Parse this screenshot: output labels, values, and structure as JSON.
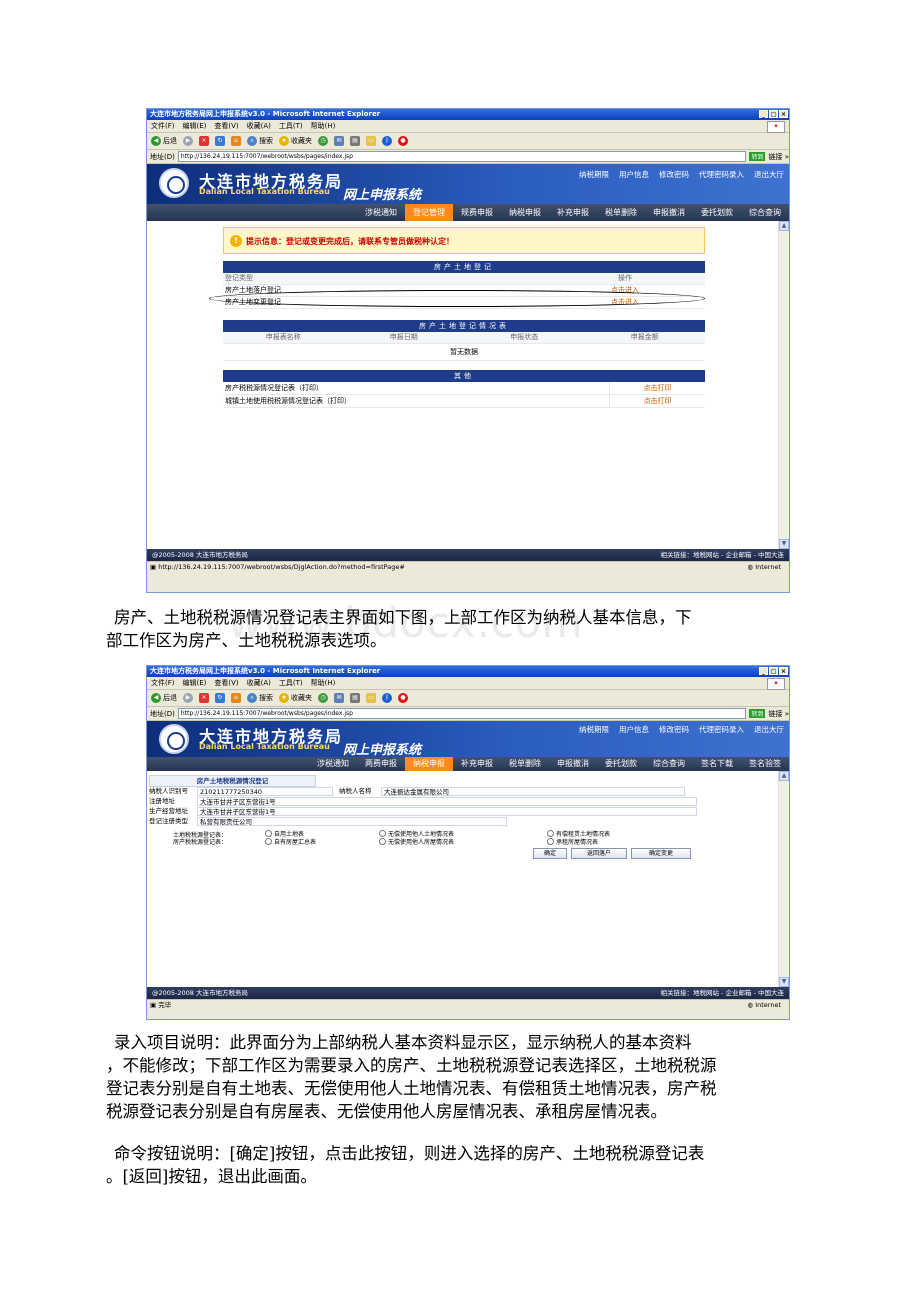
{
  "browser": {
    "title": "大连市地方税务局网上申报系统v3.0 - Microsoft Internet Explorer",
    "menu": [
      "文件(F)",
      "编辑(E)",
      "查看(V)",
      "收藏(A)",
      "工具(T)",
      "帮助(H)"
    ],
    "back_label": "后退",
    "search_label": "搜索",
    "favorites_label": "收藏夹",
    "address_label": "地址(D)",
    "address_url": "http://136.24.19.115:7007/webroot/wsbs/pages/index.jsp",
    "go_label": "转到",
    "links_label": "链接 »"
  },
  "site": {
    "bureau_cn": "大连市地方税务局",
    "bureau_en": "Dalian Local Taxation Bureau",
    "system_name": "网上申报系统",
    "top_links": [
      "纳税期限",
      "用户信息",
      "修改密码",
      "代理密码录入",
      "退出大厅"
    ],
    "copyright": "@2005-2008 大连市地方税务局",
    "related": "相关链接：地税网站 - 企业邮箱 - 中国大连",
    "internet_label": "Internet"
  },
  "screenshot1": {
    "nav": [
      "涉税通知",
      "登记管理",
      "规费申报",
      "纳税申报",
      "补充申报",
      "税单删除",
      "申报撤消",
      "委托划款",
      "综合查询"
    ],
    "nav_active": "登记管理",
    "notice": "提示信息：登记或变更完成后，请联系专管员做税种认定！",
    "section1": {
      "title": "房产土地登记",
      "col_type": "登记类型",
      "col_op": "操作",
      "rows": [
        {
          "name": "房产土地落户登记",
          "op": "点击进入"
        },
        {
          "name": "房产土地变更登记",
          "op": "点击进入"
        }
      ]
    },
    "section2": {
      "title": "房产土地登记情况表",
      "cols": [
        "申报表名称",
        "申报日期",
        "申报状态",
        "申报金额"
      ],
      "nodata": "暂无数据"
    },
    "section3": {
      "title": "其他",
      "rows": [
        {
          "name": "房产税税源情况登记表（打印）",
          "op": "点击打印"
        },
        {
          "name": "城镇土地使用税税源情况登记表（打印）",
          "op": "点击打印"
        }
      ]
    },
    "status_url": "http://136.24.19.115:7007/webroot/wsbs/DjglAction.do?method=firstPage#"
  },
  "paragraph1": {
    "line1": "房产、土地税税源情况登记表主界面如下图，上部工作区为纳税人基本信息，下",
    "line2": "部工作区为房产、土地税税源表选项。"
  },
  "watermark": "www.bdocx.com",
  "screenshot2": {
    "nav": [
      "涉税通知",
      "两费申报",
      "纳税申报",
      "补充申报",
      "税单删除",
      "申报撤消",
      "委托划款",
      "综合查询",
      "签名下载",
      "签名验签"
    ],
    "nav_active": "纳税申报",
    "form_title": "房产土地税税源情况登记",
    "fields": {
      "taxpayer_id_label": "纳税人识别号",
      "taxpayer_id": "210211777250340",
      "taxpayer_name_label": "纳税人名称",
      "taxpayer_name": "大连振达金属有限公司",
      "reg_addr_label": "注册地址",
      "reg_addr": "大连市甘井子区东营街1号",
      "biz_addr_label": "生产经营地址",
      "biz_addr": "大连市甘井子区东营街1号",
      "reg_type_label": "登记注册类型",
      "reg_type": "私营有限责任公司"
    },
    "land_label": "土地税税源登记表：",
    "house_label": "房产税税源登记表：",
    "land_options": [
      "自用土地表",
      "无偿使用他人土地情况表",
      "有偿租赁土地情况表"
    ],
    "house_options": [
      "自有房屋汇总表",
      "无偿使用他人房屋情况表",
      "承租房屋情况表"
    ],
    "buttons": [
      "确定",
      "返回落户",
      "确定变更"
    ],
    "status": "完毕"
  },
  "paragraph2": {
    "line1": "录入项目说明：此界面分为上部纳税人基本资料显示区，显示纳税人的基本资料",
    "line2": "，不能修改；下部工作区为需要录入的房产、土地税税源登记表选择区，土地税税源",
    "line3": "登记表分别是自有土地表、无偿使用他人土地情况表、有偿租赁土地情况表，房产税",
    "line4": "税源登记表分别是自有房屋表、无偿使用他人房屋情况表、承租房屋情况表。"
  },
  "paragraph3": {
    "line1": "命令按钮说明：[确定]按钮，点击此按钮，则进入选择的房产、土地税税源登记表",
    "line2": "。[返回]按钮，退出此画面。"
  }
}
